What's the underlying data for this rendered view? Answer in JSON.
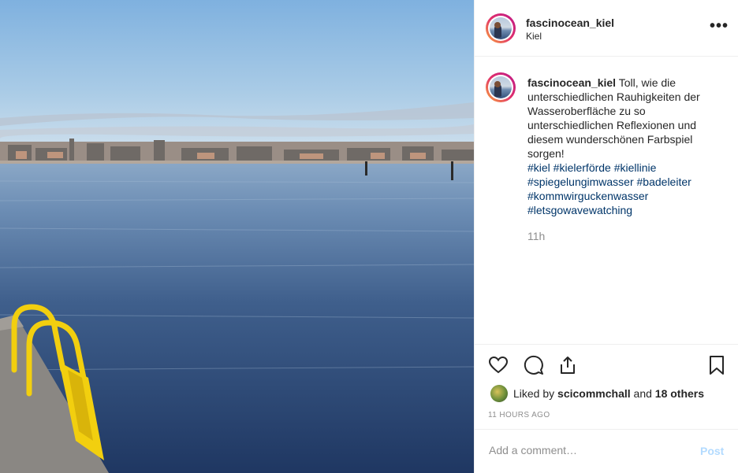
{
  "post": {
    "username": "fascinocean_kiel",
    "location": "Kiel",
    "more_icon": "ellipsis-icon",
    "caption_text": "Toll, wie die unterschiedlichen Rauhigkeiten der Wasseroberfläche zu so unterschiedlichen Reflexionen und diesem wunderschönen Farbspiel sorgen!",
    "hashtags": [
      "#kiel #kielerförde #kiellinie",
      "#spiegelungimwasser #badeleiter",
      "#kommwirguckenwasser",
      "#letsgowavewatching"
    ],
    "caption_time": "11h",
    "likes_prefix": "Liked by",
    "liked_by_user": "scicommchall",
    "likes_and": "and",
    "likes_others": "18 others",
    "timestamp": "11 HOURS AGO",
    "comment_placeholder": "Add a comment…",
    "post_button": "Post"
  },
  "icons": {
    "like": "heart-icon",
    "comment": "comment-icon",
    "share": "share-icon",
    "save": "bookmark-icon"
  },
  "colors": {
    "link": "#003569",
    "post_disabled": "#b3dbff",
    "meta_grey": "#8e8e8e"
  }
}
